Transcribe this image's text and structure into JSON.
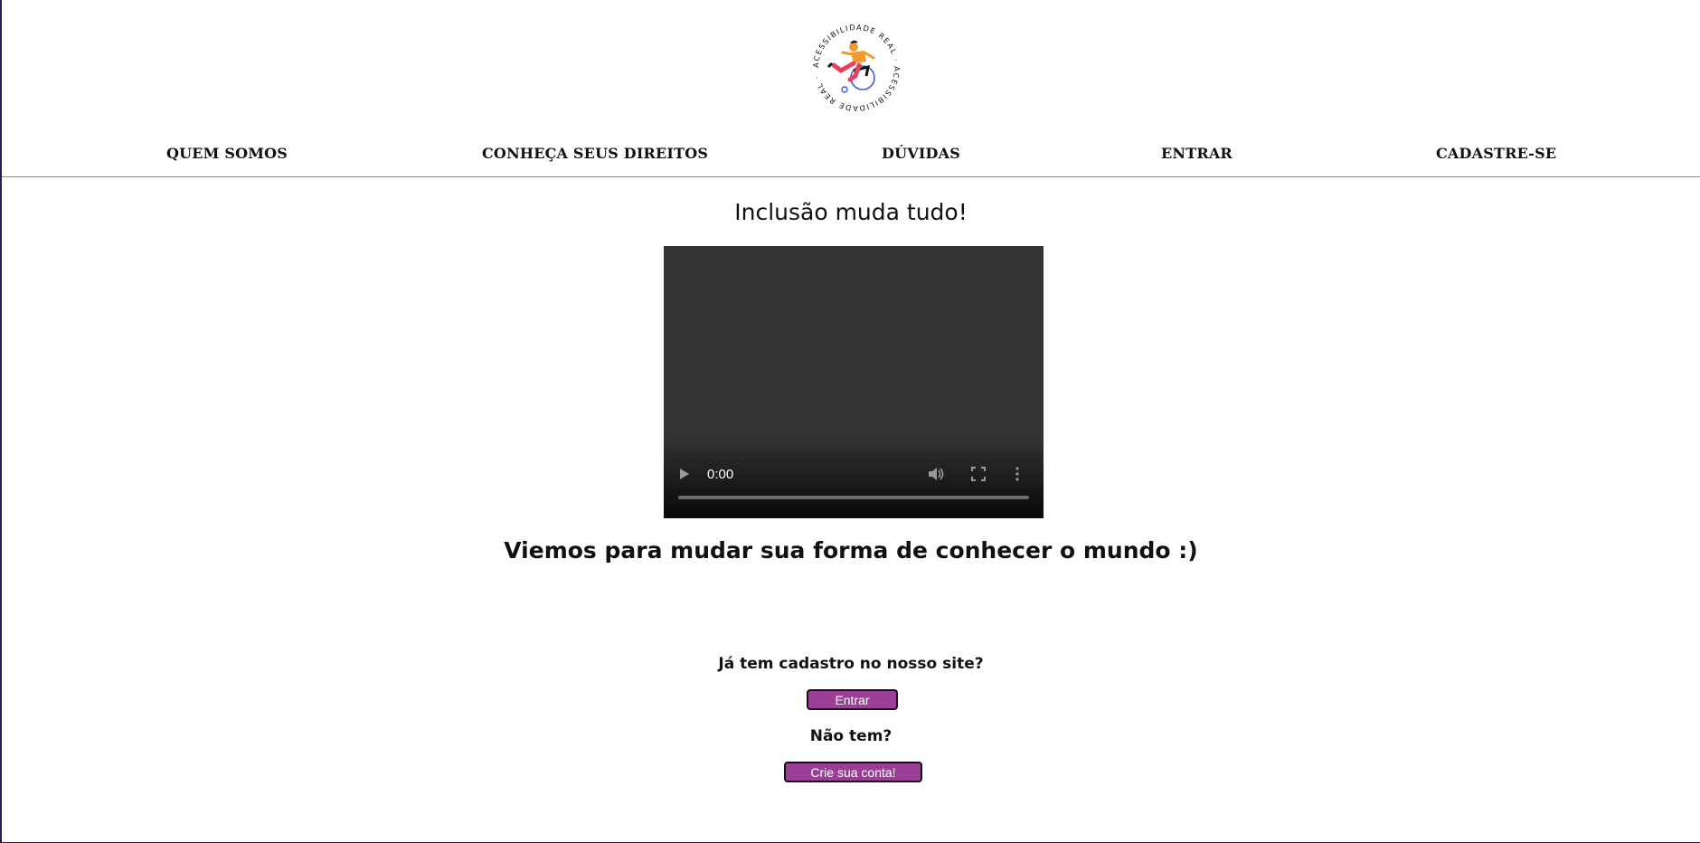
{
  "logo": {
    "ring_text": "ACESSIBILIDADE REAL · ACESSIBILIDADE REAL ·",
    "colors": {
      "skin": "#f29a2e",
      "pants": "#e8405a",
      "wheel": "#3f5bd9",
      "text": "#111111"
    }
  },
  "nav": {
    "items": [
      {
        "label": "QUEM SOMOS"
      },
      {
        "label": "CONHEÇA SEUS DIREITOS"
      },
      {
        "label": "DÚVIDAS"
      },
      {
        "label": "ENTRAR"
      },
      {
        "label": "CADASTRE-SE"
      }
    ]
  },
  "main": {
    "headline": "Inclusão muda tudo!",
    "video": {
      "time": "0:00",
      "icons": [
        "play-icon",
        "volume-icon",
        "fullscreen-icon",
        "more-options-icon"
      ]
    },
    "subheadline": "Viemos para mudar sua forma de conhecer o mundo :)"
  },
  "cta": {
    "login_question": "Já tem cadastro no nosso site?",
    "login_button": "Entrar",
    "signup_question": "Não tem?",
    "signup_button": "Crie sua conta!",
    "button_color": "#9a3e96"
  }
}
